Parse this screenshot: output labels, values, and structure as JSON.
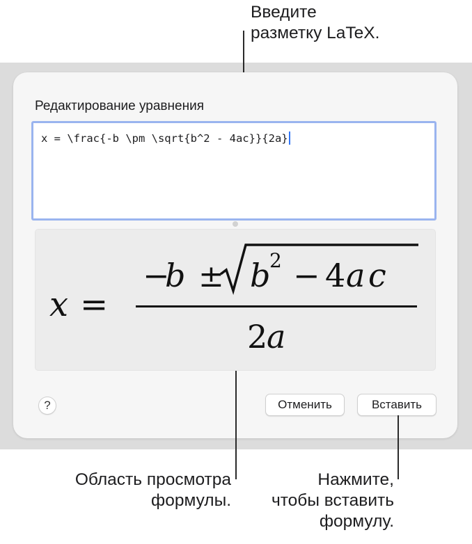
{
  "callouts": {
    "top": {
      "line1": "Введите",
      "line2": "разметку LaTeX."
    },
    "left": {
      "line1": "Область просмотра",
      "line2": "формулы."
    },
    "right": {
      "line1": "Нажмите,",
      "line2": "чтобы вставить",
      "line3": "формулу."
    }
  },
  "dialog": {
    "title": "Редактирование уравнения",
    "latex_input": "x = \\frac{-b \\pm \\sqrt{b^2 - 4ac}}{2a}",
    "preview": {
      "lhs": "x",
      "equals": "=",
      "numerator_minus": "−",
      "numerator_b": "b",
      "plus_minus": "±",
      "radicand_b": "b",
      "exponent": "2",
      "minus": "−",
      "four": "4",
      "a": "a",
      "c": "c",
      "denominator_two": "2",
      "denominator_a": "a"
    },
    "help_label": "?",
    "cancel_label": "Отменить",
    "insert_label": "Вставить"
  },
  "colors": {
    "focus_ring": "#9ab4ef",
    "caret": "#3478f6",
    "backdrop": "#dcdcdc"
  }
}
